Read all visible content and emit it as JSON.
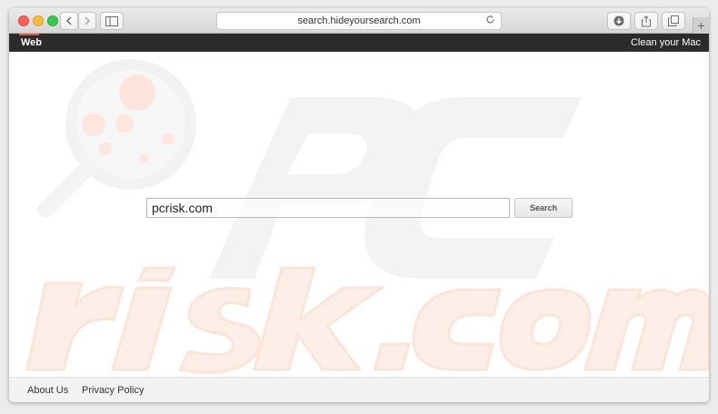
{
  "browser": {
    "url": "search.hideyoursearch.com",
    "new_tab_label": "+"
  },
  "topnav": {
    "web_label": "Web",
    "clean_label": "Clean your Mac",
    "accent_color": "#e8583d"
  },
  "search": {
    "value": "pcrisk.com",
    "button_label": "Search"
  },
  "footer": {
    "links": [
      "About Us",
      "Privacy Policy"
    ]
  },
  "icons": {
    "back": "back-arrow-icon",
    "forward": "forward-arrow-icon",
    "sidebar": "sidebar-icon",
    "reload": "reload-icon",
    "download": "download-icon",
    "share": "share-icon",
    "tabs": "tabs-overview-icon"
  }
}
